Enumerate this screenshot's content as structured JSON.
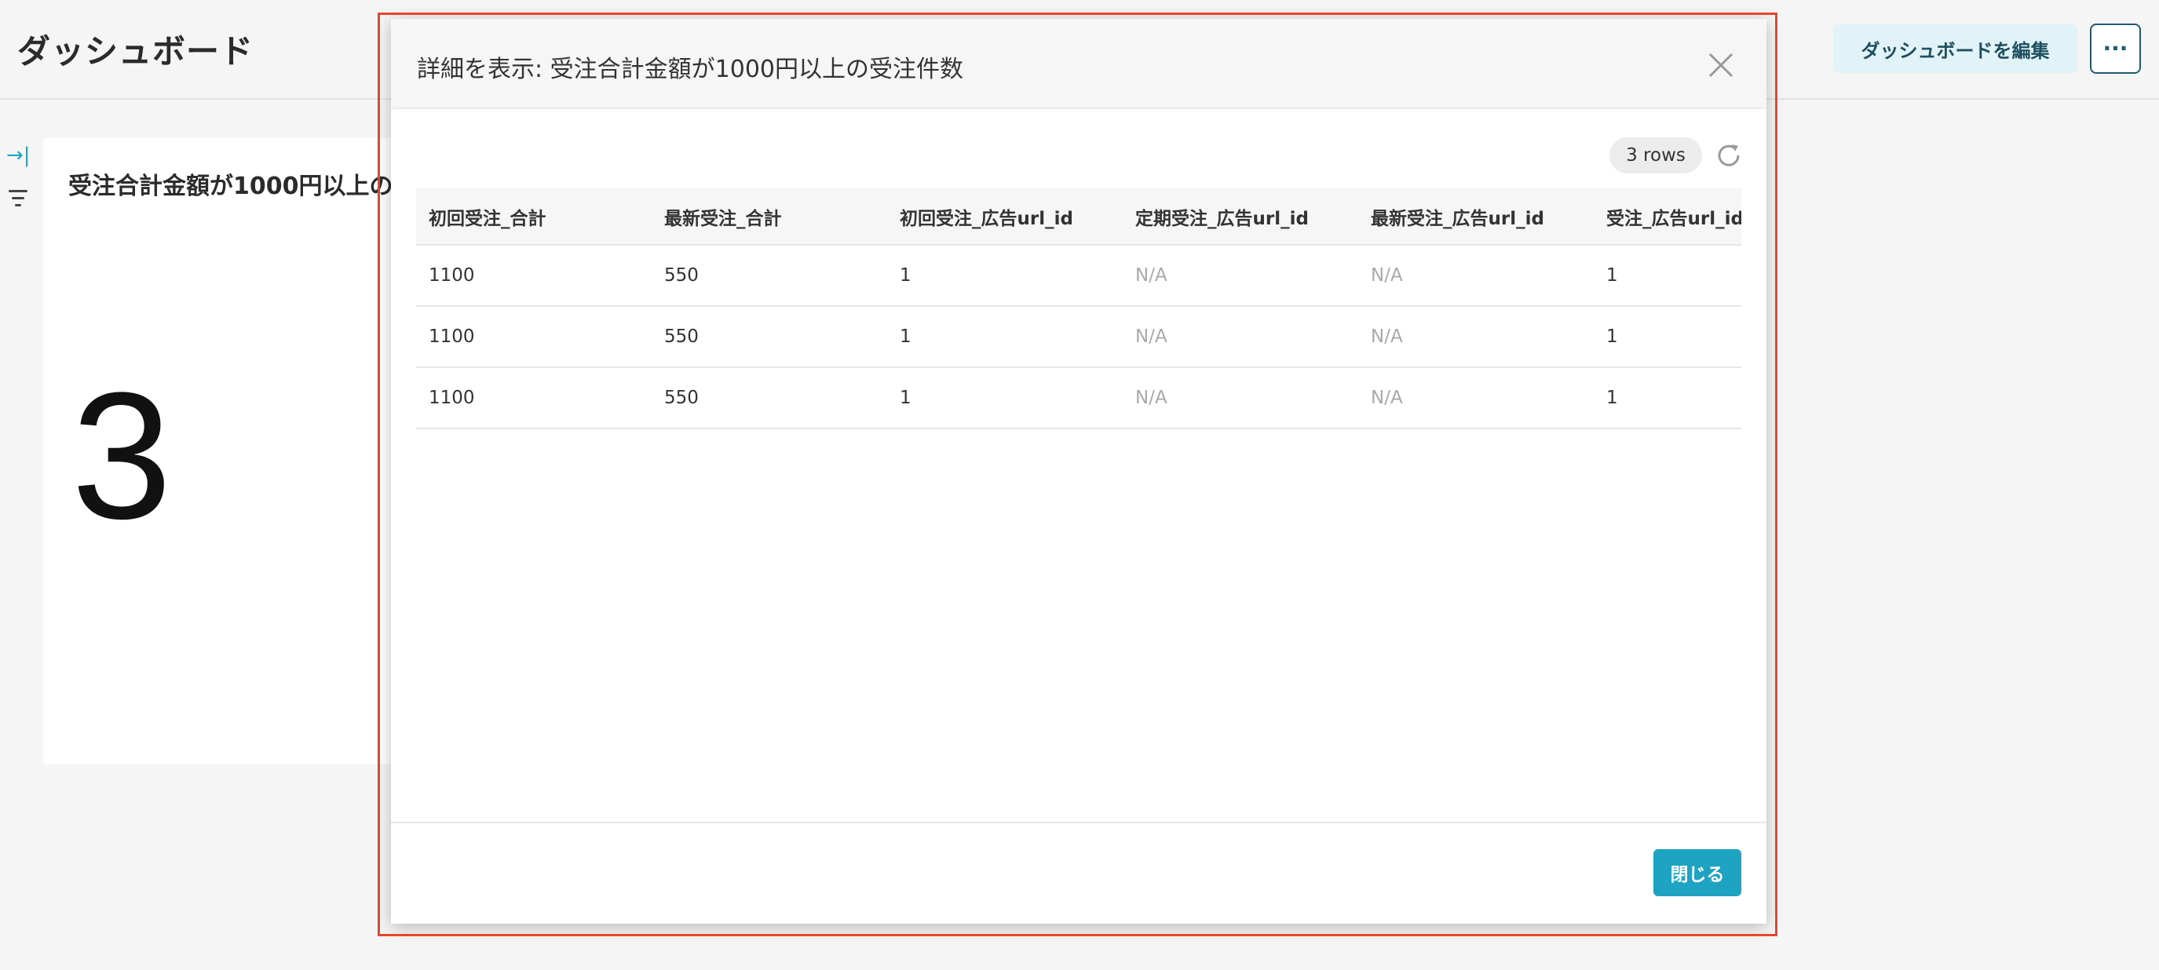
{
  "header": {
    "title": "ダッシュボード",
    "edit_label": "ダッシュボードを編集",
    "more_label": "···"
  },
  "sidebar": {
    "expand_icon": "→|",
    "icons": [
      "expand-icon",
      "filter-icon"
    ]
  },
  "card": {
    "title": "受注合計金額が1000円以上の",
    "value": "3"
  },
  "modal": {
    "title": "詳細を表示: 受注合計金額が1000円以上の受注件数",
    "rows_badge": "3 rows",
    "columns": [
      "初回受注_合計",
      "最新受注_合計",
      "初回受注_広告url_id",
      "定期受注_広告url_id",
      "最新受注_広告url_id",
      "受注_広告url_id"
    ],
    "rows": [
      [
        "1100",
        "550",
        "1",
        "N/A",
        "N/A",
        "1"
      ],
      [
        "1100",
        "550",
        "1",
        "N/A",
        "N/A",
        "1"
      ],
      [
        "1100",
        "550",
        "1",
        "N/A",
        "N/A",
        "1"
      ]
    ],
    "close_label": "閉じる"
  },
  "colors": {
    "accent": "#1ea3c2",
    "highlight": "#e8452c",
    "na_text": "#a9a9a9"
  }
}
